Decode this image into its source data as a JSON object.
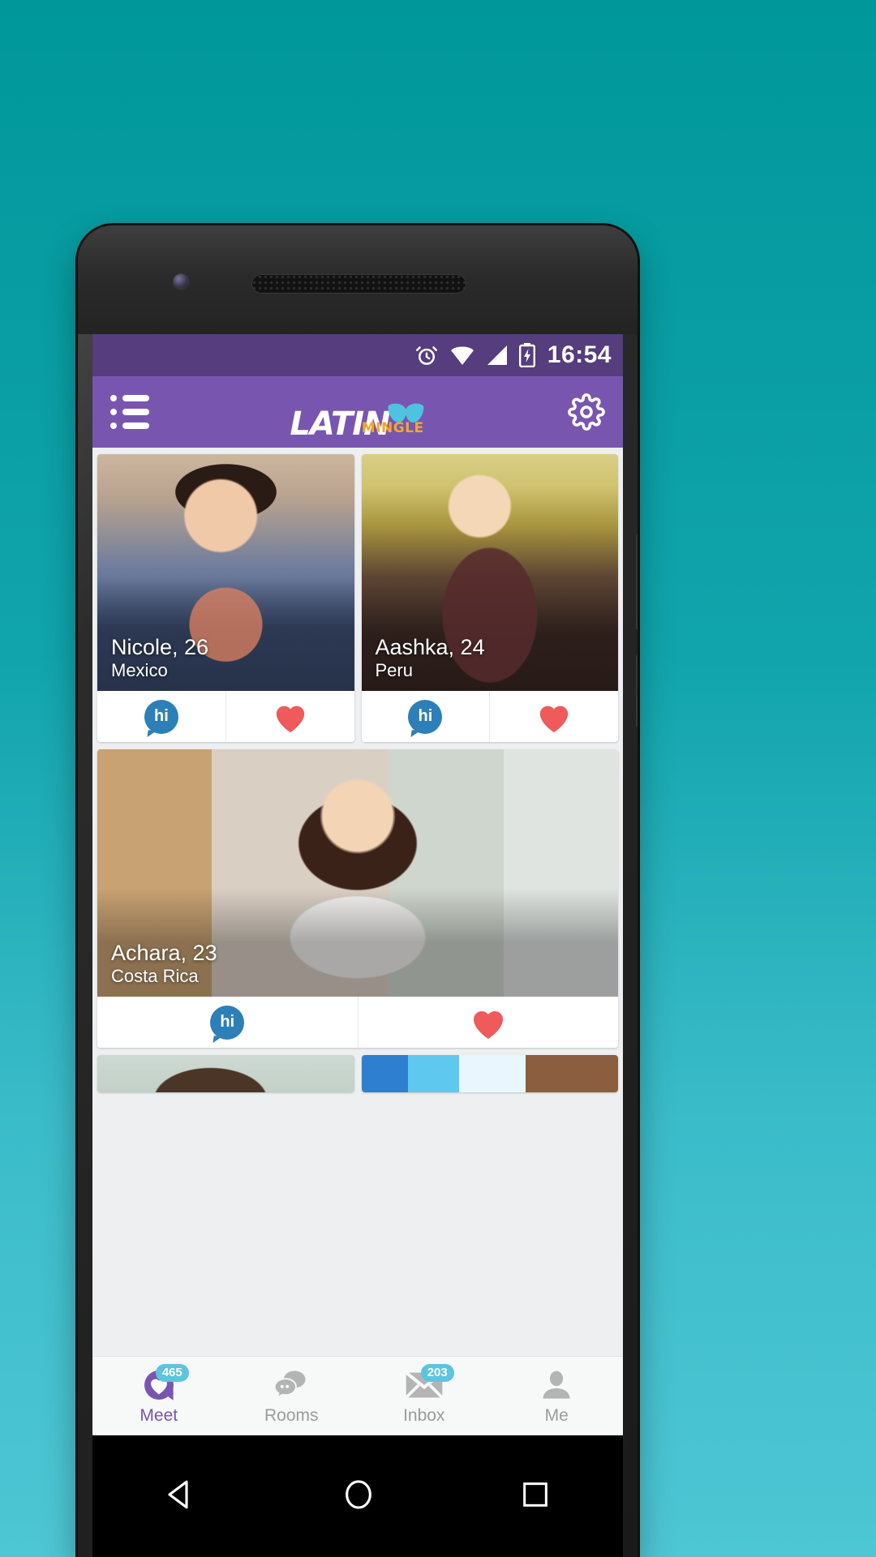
{
  "background": {
    "top_color": "#00979a",
    "bottom_color": "#4ec6d4"
  },
  "statusbar": {
    "time": "16:54",
    "background": "#553d7e",
    "icons": [
      "alarm-icon",
      "wifi-icon",
      "cellular-signal-icon",
      "battery-charging-icon"
    ]
  },
  "appbar": {
    "background": "#7856b0",
    "menu_icon": "hamburger-list-icon",
    "settings_icon": "gear-icon",
    "brand": {
      "primary": "LATIN",
      "secondary": "MINGLE",
      "primary_color": "#ffffff",
      "secondary_color": "#f6a623",
      "mask_color": "#4ec3e0"
    }
  },
  "feed": {
    "rows": [
      {
        "layout": "half",
        "cards": [
          {
            "name": "Nicole, 26",
            "location": "Mexico",
            "hi_label": "hi",
            "photo": "man-in-denim-shirt-smiling"
          },
          {
            "name": "Aashka, 24",
            "location": "Peru",
            "hi_label": "hi",
            "photo": "blonde-woman-outdoors"
          }
        ]
      },
      {
        "layout": "full",
        "cards": [
          {
            "name": "Achara, 23",
            "location": "Costa Rica",
            "hi_label": "hi",
            "photo": "woman-with-dark-curly-hair-smiling"
          }
        ]
      },
      {
        "layout": "peek",
        "cards": [
          {
            "name": "",
            "location": "",
            "hi_label": "",
            "photo": "partial-card-brown-hair"
          },
          {
            "name": "",
            "location": "",
            "hi_label": "",
            "photo": "partial-card-blue-background"
          }
        ]
      }
    ],
    "like_color": "#ef5a5a",
    "hi_color": "#2d7fb8"
  },
  "bottomnav": {
    "active_color": "#7856b0",
    "inactive_color": "#9b9b9b",
    "badge_color": "#5cc4de",
    "items": [
      {
        "label": "Meet",
        "icon": "heart-in-circle-icon",
        "badge": "465",
        "active": true
      },
      {
        "label": "Rooms",
        "icon": "chat-bubbles-icon",
        "badge": "",
        "active": false
      },
      {
        "label": "Inbox",
        "icon": "envelope-icon",
        "badge": "203",
        "active": false
      },
      {
        "label": "Me",
        "icon": "person-icon",
        "badge": "",
        "active": false
      }
    ]
  },
  "androidnav": {
    "buttons": [
      {
        "icon": "back-triangle-icon"
      },
      {
        "icon": "home-circle-icon"
      },
      {
        "icon": "recents-square-icon"
      }
    ]
  }
}
